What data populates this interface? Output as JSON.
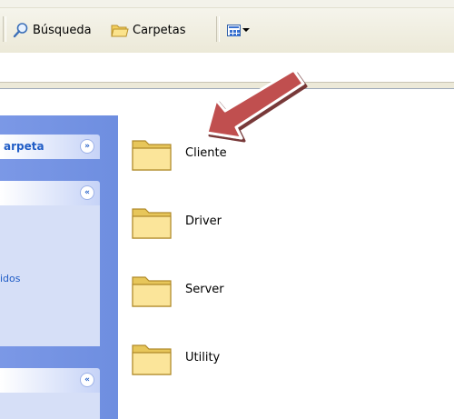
{
  "toolbar": {
    "search_label": "Búsqueda",
    "folders_label": "Carpetas",
    "views_icon": "views-grid-icon"
  },
  "taskpane": {
    "panel1_title": "arpeta",
    "panel1_state": "collapsed",
    "panel2_state": "expanded",
    "panel2_link": "idos",
    "panel3_state": "expanded"
  },
  "files": {
    "items": [
      {
        "name": "Cliente",
        "icon": "folder-icon"
      },
      {
        "name": "Driver",
        "icon": "folder-icon"
      },
      {
        "name": "Server",
        "icon": "folder-icon"
      },
      {
        "name": "Utility",
        "icon": "folder-icon"
      }
    ]
  },
  "annotation": {
    "arrow_color": "#b8504f",
    "points_to": "Cliente"
  }
}
